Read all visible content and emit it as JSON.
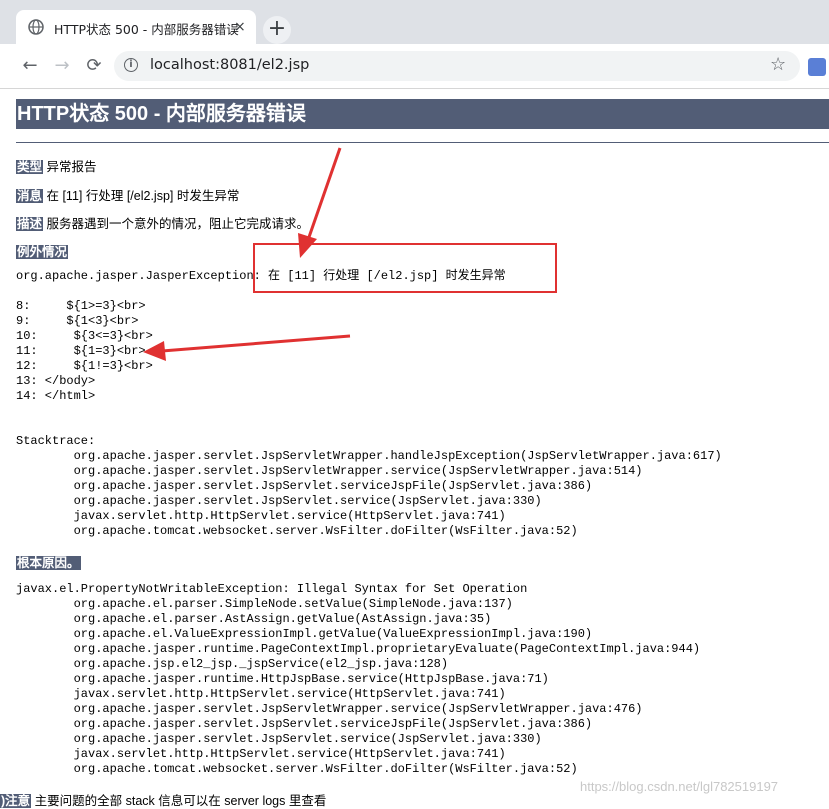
{
  "browser": {
    "tab_title": "HTTP状态 500 - 内部服务器错误",
    "tab_close": "×",
    "new_tab": "+",
    "url": "localhost:8081/el2.jsp",
    "back": "←",
    "forward": "→",
    "reload": "⟳",
    "star": "☆",
    "info": "i"
  },
  "page": {
    "title": "HTTP状态 500 - 内部服务器错误",
    "type_label": "类型",
    "type_value": " 异常报告",
    "message_label": "消息",
    "message_value": " 在 [11] 行处理 [/el2.jsp] 时发生异常",
    "description_label": "描述",
    "description_value": " 服务器遇到一个意外的情况，阻止它完成请求。",
    "exception_label": "例外情况",
    "exception_text": "org.apache.jasper.JasperException: 在 [11] 行处理 [/el2.jsp] 时发生异常\n\n8:     ${1>=3}<br>\n9:     ${1<3}<br>\n10:     ${3<=3}<br>\n11:     ${1=3}<br>\n12:     ${1!=3}<br>\n13: </body>\n14: </html>\n\n\nStacktrace:\n\torg.apache.jasper.servlet.JspServletWrapper.handleJspException(JspServletWrapper.java:617)\n\torg.apache.jasper.servlet.JspServletWrapper.service(JspServletWrapper.java:514)\n\torg.apache.jasper.servlet.JspServlet.serviceJspFile(JspServlet.java:386)\n\torg.apache.jasper.servlet.JspServlet.service(JspServlet.java:330)\n\tjavax.servlet.http.HttpServlet.service(HttpServlet.java:741)\n\torg.apache.tomcat.websocket.server.WsFilter.doFilter(WsFilter.java:52)",
    "root_cause_label": "根本原因。",
    "root_cause_text": "javax.el.PropertyNotWritableException: Illegal Syntax for Set Operation\n\torg.apache.el.parser.SimpleNode.setValue(SimpleNode.java:137)\n\torg.apache.el.parser.AstAssign.getValue(AstAssign.java:35)\n\torg.apache.el.ValueExpressionImpl.getValue(ValueExpressionImpl.java:190)\n\torg.apache.jasper.runtime.PageContextImpl.proprietaryEvaluate(PageContextImpl.java:944)\n\torg.apache.jsp.el2_jsp._jspService(el2_jsp.java:128)\n\torg.apache.jasper.runtime.HttpJspBase.service(HttpJspBase.java:71)\n\tjavax.servlet.http.HttpServlet.service(HttpServlet.java:741)\n\torg.apache.jasper.servlet.JspServletWrapper.service(JspServletWrapper.java:476)\n\torg.apache.jasper.servlet.JspServlet.serviceJspFile(JspServlet.java:386)\n\torg.apache.jasper.servlet.JspServlet.service(JspServlet.java:330)\n\tjavax.servlet.http.HttpServlet.service(HttpServlet.java:741)\n\torg.apache.tomcat.websocket.server.WsFilter.doFilter(WsFilter.java:52)",
    "note_label": ")注意",
    "note_value": " 主要问题的全部 stack 信息可以在 server logs 里查看",
    "watermark": "https://blog.csdn.net/lgl782519197"
  },
  "colors": {
    "header_bg": "#525d76",
    "annotation_red": "#e03131"
  }
}
